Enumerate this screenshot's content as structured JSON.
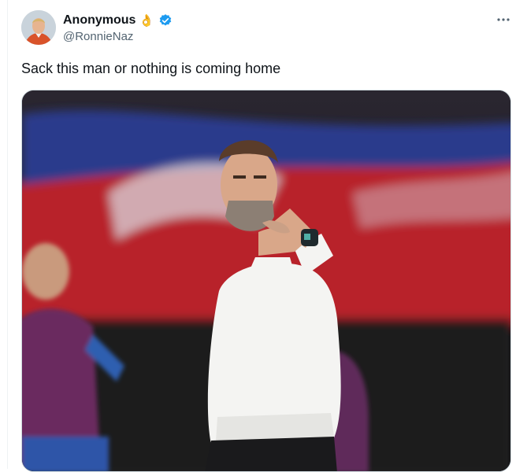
{
  "user": {
    "display_name": "Anonymous",
    "name_emoji": "👌",
    "handle": "@RonnieNaz",
    "verified": true,
    "verified_color": "#1d9bf0"
  },
  "tweet": {
    "text": "Sack this man or nothing is coming home"
  },
  "media": {
    "type": "photo",
    "colors": {
      "stadium_red": "#b8242c",
      "stadium_blue": "#2a3a8c",
      "shirt": "#f4f4f2"
    }
  },
  "icons": {
    "more": "more-horizontal-icon",
    "verified": "verified-badge-icon"
  }
}
